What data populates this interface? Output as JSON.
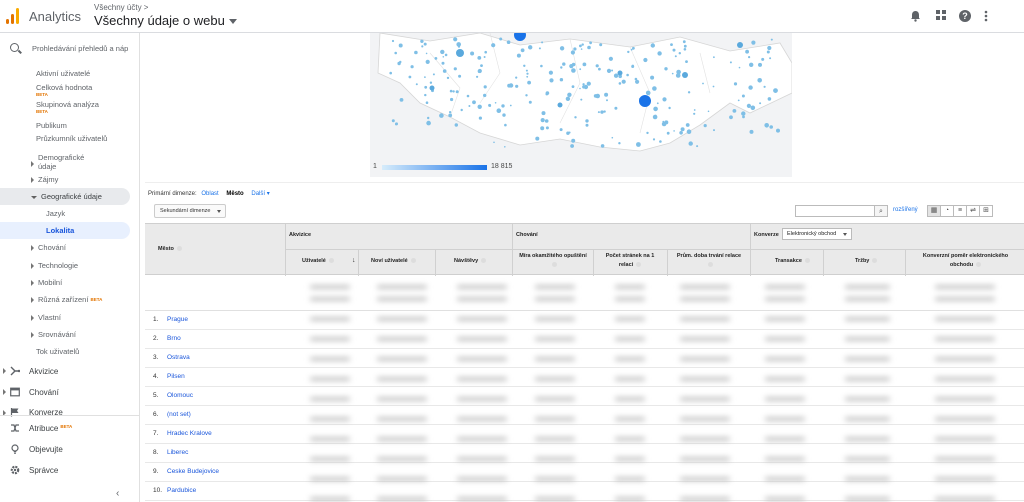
{
  "header": {
    "brand": "Analytics",
    "account_small": "Všechny účty >",
    "account_view": "Všechny údaje o webu",
    "logo_colors": [
      "#f9ab00",
      "#e37400",
      "#e37400"
    ]
  },
  "sidebar": {
    "search_placeholder": "Prohledávání přehledů a náp",
    "items": [
      {
        "label": "Aktivní uživatelé"
      },
      {
        "label": "Celková hodnota",
        "badge": "BETA"
      },
      {
        "label": "Skupinová analýza",
        "badge": "BETA"
      },
      {
        "label": "Publikum"
      },
      {
        "label": "Průzkumník uživatelů"
      },
      {
        "label": "Demografické údaje"
      },
      {
        "label": "Zájmy"
      },
      {
        "label": "Geografické údaje"
      },
      {
        "label": "Jazyk"
      },
      {
        "label": "Lokalita"
      },
      {
        "label": "Chování"
      },
      {
        "label": "Technologie"
      },
      {
        "label": "Mobilní"
      },
      {
        "label": "Různá zařízení",
        "badge": "BETA"
      },
      {
        "label": "Vlastní"
      },
      {
        "label": "Srovnávání"
      },
      {
        "label": "Tok uživatelů"
      }
    ],
    "sections": [
      {
        "label": "Akvizice",
        "icon": "acquisition-icon"
      },
      {
        "label": "Chování",
        "icon": "behavior-icon"
      },
      {
        "label": "Konverze",
        "icon": "flag-icon"
      }
    ],
    "bottom": [
      {
        "label": "Atribuce",
        "badge": "BETA",
        "icon": "attribution-icon"
      },
      {
        "label": "Objevujte",
        "icon": "lightbulb-icon"
      },
      {
        "label": "Správce",
        "icon": "gear-icon"
      }
    ]
  },
  "map": {
    "legend_min": "1",
    "legend_max": "18 815",
    "accent": "#1a73e8"
  },
  "table": {
    "primary_dim_label": "Primární dimenze:",
    "dim_area": "Oblast",
    "dim_city": "Město",
    "dim_more": "Další",
    "secondary_dim": "Sekundární dimenze",
    "advanced": "rozšířený",
    "col_city": "Město",
    "group_acq": "Akvizice",
    "group_beh": "Chování",
    "group_conv": "Konverze",
    "conv_select": "Elektronický obchod",
    "cols": [
      "Uživatelé",
      "Noví uživatelé",
      "Návštěvy",
      "Míra okamžitého opuštění",
      "Počet stránek na 1",
      "relaci",
      "Prům. doba trvání relace",
      "Transakce",
      "Tržby",
      "Konverzní poměr elektronického",
      "obchodu"
    ],
    "rows": [
      {
        "num": "1.",
        "city": "Prague"
      },
      {
        "num": "2.",
        "city": "Brno"
      },
      {
        "num": "3.",
        "city": "Ostrava"
      },
      {
        "num": "4.",
        "city": "Pilsen"
      },
      {
        "num": "5.",
        "city": "Olomouc"
      },
      {
        "num": "6.",
        "city": "(not set)"
      },
      {
        "num": "7.",
        "city": "Hradec Kralove"
      },
      {
        "num": "8.",
        "city": "Liberec"
      },
      {
        "num": "9.",
        "city": "Ceske Budejovice"
      },
      {
        "num": "10.",
        "city": "Pardubice"
      }
    ]
  }
}
